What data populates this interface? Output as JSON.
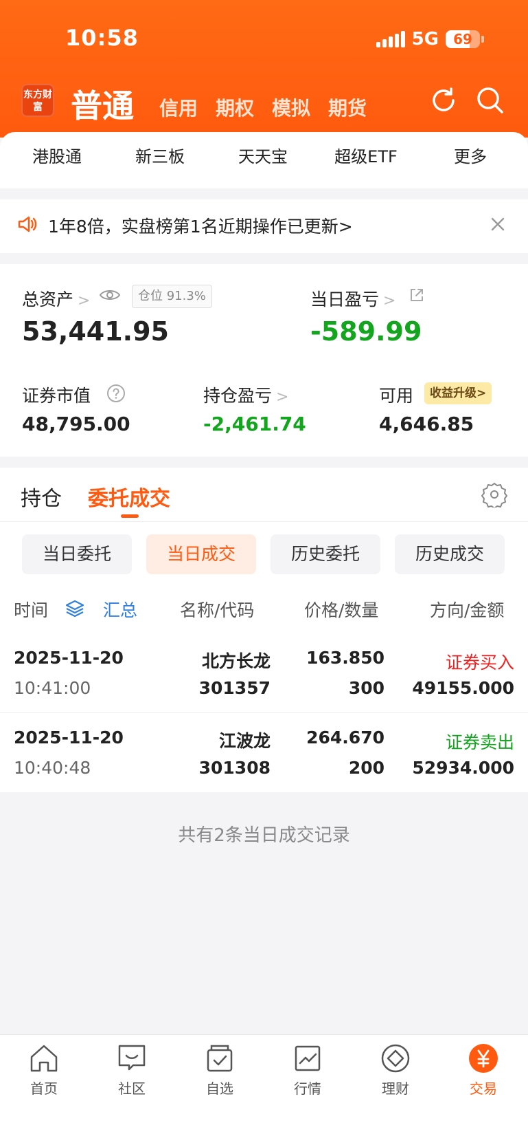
{
  "status_bar": {
    "time": "10:58",
    "network": "5G",
    "battery": "69",
    "battery_level": 0.69
  },
  "header": {
    "logo_text": "东方财富",
    "account_type": "普通",
    "tabs": [
      "信用",
      "期权",
      "模拟",
      "期货"
    ]
  },
  "quick_links": [
    "港股通",
    "新三板",
    "天天宝",
    "超级ETF",
    "更多"
  ],
  "notice": {
    "text": "1年8倍，实盘榜第1名近期操作已更新>"
  },
  "assets": {
    "total_label": "总资产",
    "position_badge": "仓位 91.3%",
    "total_value": "53,441.95",
    "daily_pnl_label": "当日盈亏",
    "daily_pnl_value": "-589.99",
    "market_value_label": "证券市值",
    "market_value": "48,795.00",
    "holding_pnl_label": "持仓盈亏",
    "holding_pnl_value": "-2,461.74",
    "available_label": "可用",
    "upgrade_badge": "收益升级>",
    "available_value": "4,646.85"
  },
  "list_tabs": [
    "持仓",
    "委托成交"
  ],
  "segments": [
    "当日委托",
    "当日成交",
    "历史委托",
    "历史成交"
  ],
  "table": {
    "headers": {
      "time": "时间",
      "summary": "汇总",
      "name_code": "名称/代码",
      "price_qty": "价格/数量",
      "dir_amount": "方向/金额"
    },
    "rows": [
      {
        "date": "2025-11-20",
        "time": "10:41:00",
        "name": "北方长龙",
        "code": "301357",
        "price": "163.850",
        "qty": "300",
        "direction": "证券买入",
        "amount": "49155.000"
      },
      {
        "date": "2025-11-20",
        "time": "10:40:48",
        "name": "江波龙",
        "code": "301308",
        "price": "264.670",
        "qty": "200",
        "direction": "证券卖出",
        "amount": "52934.000"
      }
    ],
    "footer": "共有2条当日成交记录"
  },
  "colors": {
    "accent": "#ff5a0f",
    "down": "#13a51e",
    "up": "#f02020",
    "link": "#2f7fe0"
  },
  "tabbar": [
    {
      "label": "首页",
      "icon": "home-icon"
    },
    {
      "label": "社区",
      "icon": "chat-icon"
    },
    {
      "label": "自选",
      "icon": "watchlist-icon"
    },
    {
      "label": "行情",
      "icon": "chart-icon"
    },
    {
      "label": "理财",
      "icon": "diamond-icon"
    },
    {
      "label": "交易",
      "icon": "yuan-icon"
    }
  ]
}
